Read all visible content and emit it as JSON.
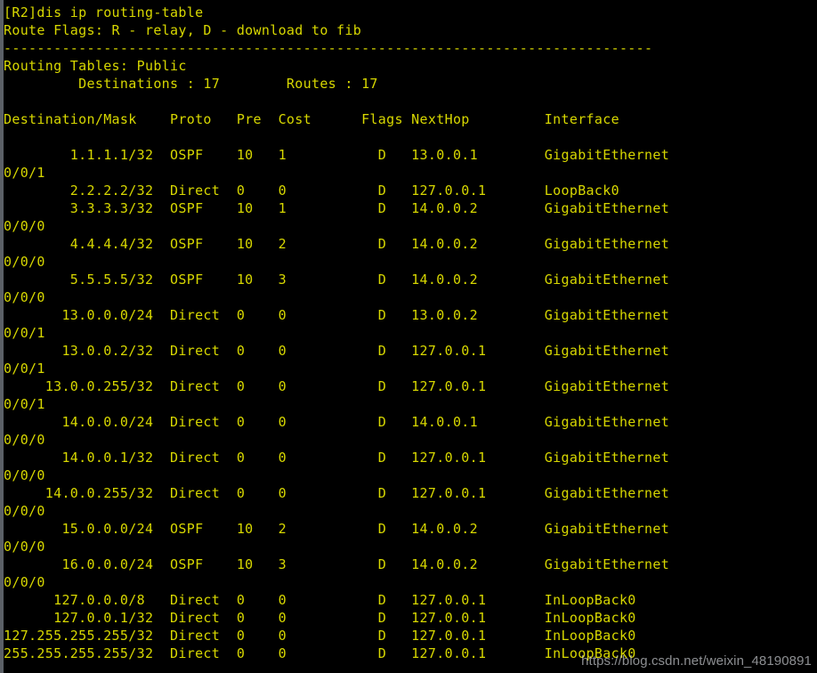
{
  "terminal": {
    "prompt_line": "[R2]dis ip routing-table",
    "route_flags_line": "Route Flags: R - relay, D - download to fib",
    "separator": "------------------------------------------------------------------------------",
    "routing_tables_line": "Routing Tables: Public",
    "summary": {
      "destinations_label": "Destinations",
      "destinations_value": "17",
      "routes_label": "Routes",
      "routes_value": "17",
      "line": "         Destinations : 17        Routes : 17"
    },
    "columns": {
      "destination_mask": "Destination/Mask",
      "proto": "Proto",
      "pre": "Pre",
      "cost": "Cost",
      "flags": "Flags",
      "nexthop": "NextHop",
      "interface": "Interface",
      "header_line": "Destination/Mask    Proto   Pre  Cost      Flags NextHop         Interface"
    },
    "routes": [
      {
        "destination": "1.1.1.1/32",
        "proto": "OSPF",
        "pre": "10",
        "cost": "1",
        "flags": "D",
        "nexthop": "13.0.0.1",
        "interface": "GigabitEthernet",
        "interface_cont": "0/0/1"
      },
      {
        "destination": "2.2.2.2/32",
        "proto": "Direct",
        "pre": "0",
        "cost": "0",
        "flags": "D",
        "nexthop": "127.0.0.1",
        "interface": "LoopBack0",
        "interface_cont": ""
      },
      {
        "destination": "3.3.3.3/32",
        "proto": "OSPF",
        "pre": "10",
        "cost": "1",
        "flags": "D",
        "nexthop": "14.0.0.2",
        "interface": "GigabitEthernet",
        "interface_cont": "0/0/0"
      },
      {
        "destination": "4.4.4.4/32",
        "proto": "OSPF",
        "pre": "10",
        "cost": "2",
        "flags": "D",
        "nexthop": "14.0.0.2",
        "interface": "GigabitEthernet",
        "interface_cont": "0/0/0"
      },
      {
        "destination": "5.5.5.5/32",
        "proto": "OSPF",
        "pre": "10",
        "cost": "3",
        "flags": "D",
        "nexthop": "14.0.0.2",
        "interface": "GigabitEthernet",
        "interface_cont": "0/0/0"
      },
      {
        "destination": "13.0.0.0/24",
        "proto": "Direct",
        "pre": "0",
        "cost": "0",
        "flags": "D",
        "nexthop": "13.0.0.2",
        "interface": "GigabitEthernet",
        "interface_cont": "0/0/1"
      },
      {
        "destination": "13.0.0.2/32",
        "proto": "Direct",
        "pre": "0",
        "cost": "0",
        "flags": "D",
        "nexthop": "127.0.0.1",
        "interface": "GigabitEthernet",
        "interface_cont": "0/0/1"
      },
      {
        "destination": "13.0.0.255/32",
        "proto": "Direct",
        "pre": "0",
        "cost": "0",
        "flags": "D",
        "nexthop": "127.0.0.1",
        "interface": "GigabitEthernet",
        "interface_cont": "0/0/1"
      },
      {
        "destination": "14.0.0.0/24",
        "proto": "Direct",
        "pre": "0",
        "cost": "0",
        "flags": "D",
        "nexthop": "14.0.0.1",
        "interface": "GigabitEthernet",
        "interface_cont": "0/0/0"
      },
      {
        "destination": "14.0.0.1/32",
        "proto": "Direct",
        "pre": "0",
        "cost": "0",
        "flags": "D",
        "nexthop": "127.0.0.1",
        "interface": "GigabitEthernet",
        "interface_cont": "0/0/0"
      },
      {
        "destination": "14.0.0.255/32",
        "proto": "Direct",
        "pre": "0",
        "cost": "0",
        "flags": "D",
        "nexthop": "127.0.0.1",
        "interface": "GigabitEthernet",
        "interface_cont": "0/0/0"
      },
      {
        "destination": "15.0.0.0/24",
        "proto": "OSPF",
        "pre": "10",
        "cost": "2",
        "flags": "D",
        "nexthop": "14.0.0.2",
        "interface": "GigabitEthernet",
        "interface_cont": "0/0/0"
      },
      {
        "destination": "16.0.0.0/24",
        "proto": "OSPF",
        "pre": "10",
        "cost": "3",
        "flags": "D",
        "nexthop": "14.0.0.2",
        "interface": "GigabitEthernet",
        "interface_cont": "0/0/0"
      },
      {
        "destination": "127.0.0.0/8",
        "proto": "Direct",
        "pre": "0",
        "cost": "0",
        "flags": "D",
        "nexthop": "127.0.0.1",
        "interface": "InLoopBack0",
        "interface_cont": ""
      },
      {
        "destination": "127.0.0.1/32",
        "proto": "Direct",
        "pre": "0",
        "cost": "0",
        "flags": "D",
        "nexthop": "127.0.0.1",
        "interface": "InLoopBack0",
        "interface_cont": ""
      },
      {
        "destination": "127.255.255.255/32",
        "proto": "Direct",
        "pre": "0",
        "cost": "0",
        "flags": "D",
        "nexthop": "127.0.0.1",
        "interface": "InLoopBack0",
        "interface_cont": ""
      },
      {
        "destination": "255.255.255.255/32",
        "proto": "Direct",
        "pre": "0",
        "cost": "0",
        "flags": "D",
        "nexthop": "127.0.0.1",
        "interface": "InLoopBack0",
        "interface_cont": ""
      }
    ],
    "rendered_lines": [
      "[R2]dis ip routing-table",
      "Route Flags: R - relay, D - download to fib",
      "------------------------------------------------------------------------------",
      "Routing Tables: Public",
      "         Destinations : 17        Routes : 17",
      "",
      "Destination/Mask    Proto   Pre  Cost      Flags NextHop         Interface",
      "",
      "        1.1.1.1/32  OSPF    10   1           D   13.0.0.1        GigabitEthernet",
      "0/0/1",
      "        2.2.2.2/32  Direct  0    0           D   127.0.0.1       LoopBack0",
      "        3.3.3.3/32  OSPF    10   1           D   14.0.0.2        GigabitEthernet",
      "0/0/0",
      "        4.4.4.4/32  OSPF    10   2           D   14.0.0.2        GigabitEthernet",
      "0/0/0",
      "        5.5.5.5/32  OSPF    10   3           D   14.0.0.2        GigabitEthernet",
      "0/0/0",
      "       13.0.0.0/24  Direct  0    0           D   13.0.0.2        GigabitEthernet",
      "0/0/1",
      "       13.0.0.2/32  Direct  0    0           D   127.0.0.1       GigabitEthernet",
      "0/0/1",
      "     13.0.0.255/32  Direct  0    0           D   127.0.0.1       GigabitEthernet",
      "0/0/1",
      "       14.0.0.0/24  Direct  0    0           D   14.0.0.1        GigabitEthernet",
      "0/0/0",
      "       14.0.0.1/32  Direct  0    0           D   127.0.0.1       GigabitEthernet",
      "0/0/0",
      "     14.0.0.255/32  Direct  0    0           D   127.0.0.1       GigabitEthernet",
      "0/0/0",
      "       15.0.0.0/24  OSPF    10   2           D   14.0.0.2        GigabitEthernet",
      "0/0/0",
      "       16.0.0.0/24  OSPF    10   3           D   14.0.0.2        GigabitEthernet",
      "0/0/0",
      "      127.0.0.0/8   Direct  0    0           D   127.0.0.1       InLoopBack0",
      "      127.0.0.1/32  Direct  0    0           D   127.0.0.1       InLoopBack0",
      "127.255.255.255/32  Direct  0    0           D   127.0.0.1       InLoopBack0",
      "255.255.255.255/32  Direct  0    0           D   127.0.0.1       InLoopBack0"
    ]
  },
  "watermark": {
    "text": "https://blog.csdn.net/weixin_48190891"
  },
  "colors": {
    "foreground": "#d7d700",
    "background": "#000000",
    "gutter": "#5b6066",
    "watermark": "#e1e4e8"
  }
}
